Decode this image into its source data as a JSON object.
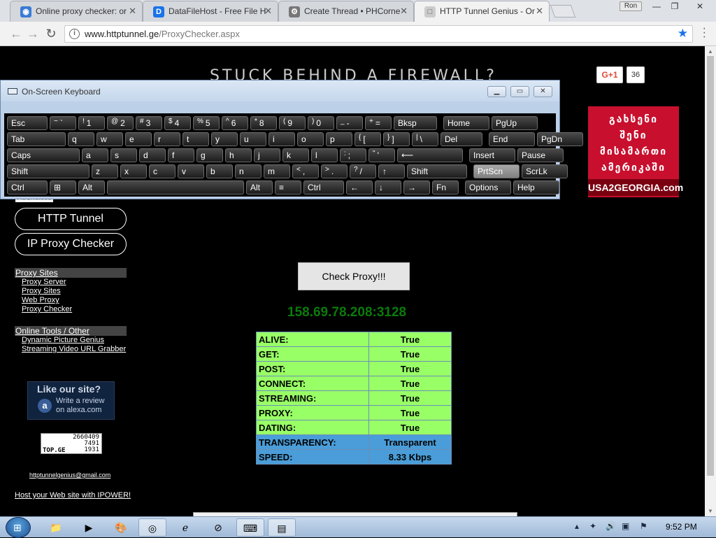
{
  "window": {
    "tabs": [
      {
        "title": "Online proxy checker: or",
        "icon_color": "#3a7bd5",
        "icon_glyph": "◉"
      },
      {
        "title": "DataFileHost - Free File H",
        "icon_color": "#1a73e8",
        "icon_glyph": "D"
      },
      {
        "title": "Create Thread • PHCorne",
        "icon_color": "#777777",
        "icon_glyph": "⚙"
      },
      {
        "title": "HTTP Tunnel Genius - Or",
        "icon_color": "#aaaaaa",
        "icon_glyph": "□"
      }
    ],
    "profile_name": "Ron"
  },
  "address_bar": {
    "url_host": "www.httptunnel.ge",
    "url_path": "/ProxyChecker.aspx"
  },
  "page": {
    "banner": "STUCK BEHIND A FIREWALL?",
    "gplus_label": "G+1",
    "gplus_count": "36",
    "ad": {
      "lines": [
        "გახსენი",
        "შენი",
        "მისამართი",
        "ამერიკაში"
      ],
      "brand": "USA2GEORGIA.com"
    },
    "adchoices": "AdChoices",
    "nav_buttons": [
      "HTTP Tunnel",
      "IP Proxy Checker"
    ],
    "proxy_sites": {
      "heading": "Proxy Sites",
      "links": [
        "Proxy Server",
        "Proxy Sites",
        "Web Proxy",
        "Proxy Checker"
      ]
    },
    "online_tools": {
      "heading": "Online Tools / Other",
      "links": [
        "Dynamic Picture Genius",
        "Streaming Video URL Grabber"
      ]
    },
    "alexa": {
      "title": "Like our site?",
      "line1": "Write a review",
      "line2": "on alexa.com"
    },
    "topge": {
      "values": [
        "2660409",
        "7491",
        "1931"
      ],
      "label": "TOP.GE"
    },
    "email": "httptunnelgenius@gmail.com",
    "host_link": "Host your Web site with IPOWER!",
    "check_button": "Check Proxy!!!",
    "proxy_address": "158.69.78.208:3128",
    "results": [
      {
        "key": "ALIVE:",
        "value": "True",
        "style": "green"
      },
      {
        "key": "GET:",
        "value": "True",
        "style": "green"
      },
      {
        "key": "POST:",
        "value": "True",
        "style": "green"
      },
      {
        "key": "CONNECT:",
        "value": "True",
        "style": "green"
      },
      {
        "key": "STREAMING:",
        "value": "True",
        "style": "green"
      },
      {
        "key": "PROXY:",
        "value": "True",
        "style": "green"
      },
      {
        "key": "DATING:",
        "value": "True",
        "style": "green"
      },
      {
        "key": "TRANSPARENCY:",
        "value": "Transparent",
        "style": "blue"
      },
      {
        "key": "SPEED:",
        "value": "8.33 Kbps",
        "style": "blue"
      }
    ]
  },
  "keyboard": {
    "title": "On-Screen Keyboard",
    "rows": [
      [
        [
          "Esc",
          ""
        ],
        [
          "`",
          "~"
        ],
        [
          "1",
          "!"
        ],
        [
          "2",
          "@"
        ],
        [
          "3",
          "#"
        ],
        [
          "4",
          "$"
        ],
        [
          "5",
          "%"
        ],
        [
          "6",
          "^"
        ],
        [
          "8",
          "*"
        ],
        [
          "9",
          "("
        ],
        [
          "0",
          ")"
        ],
        [
          "-",
          "_"
        ],
        [
          "=",
          "+"
        ],
        [
          "Bksp",
          ""
        ],
        [
          "Home",
          ""
        ],
        [
          "PgUp",
          ""
        ]
      ],
      [
        [
          "Tab",
          ""
        ],
        [
          "q",
          ""
        ],
        [
          "w",
          ""
        ],
        [
          "e",
          ""
        ],
        [
          "r",
          ""
        ],
        [
          "t",
          ""
        ],
        [
          "y",
          ""
        ],
        [
          "u",
          ""
        ],
        [
          "i",
          ""
        ],
        [
          "o",
          ""
        ],
        [
          "p",
          ""
        ],
        [
          "[",
          "{"
        ],
        [
          "]",
          "}"
        ],
        [
          "\\",
          "|"
        ],
        [
          "Del",
          ""
        ],
        [
          "End",
          ""
        ],
        [
          "PgDn",
          ""
        ]
      ],
      [
        [
          "Caps",
          ""
        ],
        [
          "a",
          ""
        ],
        [
          "s",
          ""
        ],
        [
          "d",
          ""
        ],
        [
          "f",
          ""
        ],
        [
          "g",
          ""
        ],
        [
          "h",
          ""
        ],
        [
          "j",
          ""
        ],
        [
          "k",
          ""
        ],
        [
          "l",
          ""
        ],
        [
          ";",
          ":"
        ],
        [
          "'",
          "\""
        ],
        [
          "⟵",
          ""
        ],
        [
          "Insert",
          ""
        ],
        [
          "Pause",
          ""
        ]
      ],
      [
        [
          "Shift",
          ""
        ],
        [
          "z",
          ""
        ],
        [
          "x",
          ""
        ],
        [
          "c",
          ""
        ],
        [
          "v",
          ""
        ],
        [
          "b",
          ""
        ],
        [
          "n",
          ""
        ],
        [
          "m",
          ""
        ],
        [
          ",",
          "<"
        ],
        [
          ".",
          ">"
        ],
        [
          "/",
          "?"
        ],
        [
          "↑",
          ""
        ],
        [
          "Shift",
          ""
        ],
        [
          "PrtScn",
          ""
        ],
        [
          "ScrLk",
          ""
        ]
      ],
      [
        [
          "Ctrl",
          ""
        ],
        [
          "⊞",
          ""
        ],
        [
          "Alt",
          ""
        ],
        [
          "",
          ""
        ],
        [
          "Alt",
          ""
        ],
        [
          "≡",
          ""
        ],
        [
          "Ctrl",
          ""
        ],
        [
          "←",
          ""
        ],
        [
          "↓",
          ""
        ],
        [
          "→",
          ""
        ],
        [
          "Fn",
          ""
        ],
        [
          "Options",
          ""
        ],
        [
          "Help",
          ""
        ]
      ]
    ]
  },
  "taskbar": {
    "clock": "9:52 PM",
    "items": [
      "folder",
      "media-player",
      "paint",
      "chrome",
      "ie",
      "safari",
      "keyboard",
      "notepad"
    ]
  }
}
